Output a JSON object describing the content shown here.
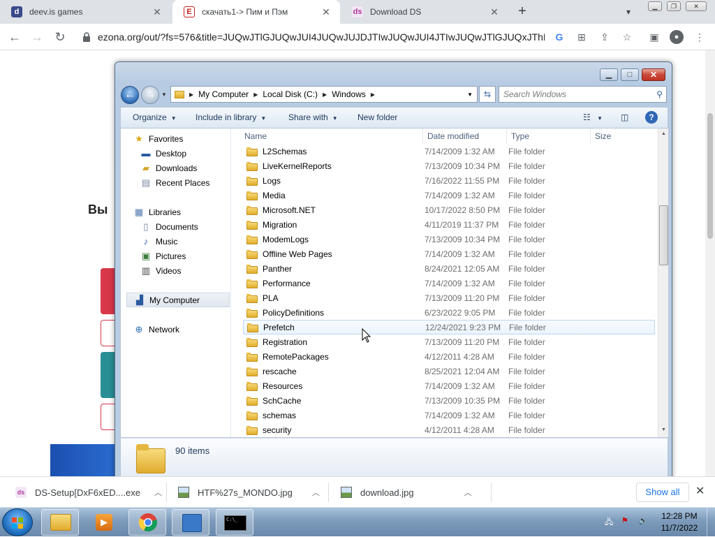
{
  "browser": {
    "tabs": [
      {
        "title": "deev.is games",
        "icon": "d-icon",
        "active": false
      },
      {
        "title": "скачать1-> Пим и Пэм",
        "icon": "e-icon",
        "active": true
      },
      {
        "title": "Download DS",
        "icon": "ds-icon",
        "active": false
      }
    ],
    "url": "ezona.org/out/?fs=576&title=JUQwJTlGJUQwJUI4JUQwJUJDJTIwJUQwJUI4JTIwJUQwJTlGJUQxJThEJU..."
  },
  "page": {
    "heading_fragment": "Вы",
    "colors": {
      "red": "#d8384a",
      "teal": "#2a8e96",
      "blue": "#1a56b0"
    }
  },
  "explorer": {
    "breadcrumb": [
      "My Computer",
      "Local Disk (C:)",
      "Windows"
    ],
    "search_placeholder": "Search Windows",
    "commands": {
      "organize": "Organize",
      "include": "Include in library",
      "share": "Share with",
      "newfolder": "New folder"
    },
    "nav": {
      "favorites": "Favorites",
      "desktop": "Desktop",
      "downloads": "Downloads",
      "recent": "Recent Places",
      "libraries": "Libraries",
      "documents": "Documents",
      "music": "Music",
      "pictures": "Pictures",
      "videos": "Videos",
      "computer": "My Computer",
      "network": "Network"
    },
    "columns": {
      "name": "Name",
      "date": "Date modified",
      "type": "Type",
      "size": "Size"
    },
    "files": [
      {
        "name": "L2Schemas",
        "date": "7/14/2009 1:32 AM",
        "type": "File folder"
      },
      {
        "name": "LiveKernelReports",
        "date": "7/13/2009 10:34 PM",
        "type": "File folder"
      },
      {
        "name": "Logs",
        "date": "7/16/2022 11:55 PM",
        "type": "File folder"
      },
      {
        "name": "Media",
        "date": "7/14/2009 1:32 AM",
        "type": "File folder"
      },
      {
        "name": "Microsoft.NET",
        "date": "10/17/2022 8:50 PM",
        "type": "File folder"
      },
      {
        "name": "Migration",
        "date": "4/11/2019 11:37 PM",
        "type": "File folder"
      },
      {
        "name": "ModemLogs",
        "date": "7/13/2009 10:34 PM",
        "type": "File folder"
      },
      {
        "name": "Offline Web Pages",
        "date": "7/14/2009 1:32 AM",
        "type": "File folder"
      },
      {
        "name": "Panther",
        "date": "8/24/2021 12:05 AM",
        "type": "File folder"
      },
      {
        "name": "Performance",
        "date": "7/14/2009 1:32 AM",
        "type": "File folder"
      },
      {
        "name": "PLA",
        "date": "7/13/2009 11:20 PM",
        "type": "File folder"
      },
      {
        "name": "PolicyDefinitions",
        "date": "6/23/2022 9:05 PM",
        "type": "File folder"
      },
      {
        "name": "Prefetch",
        "date": "12/24/2021 9:23 PM",
        "type": "File folder"
      },
      {
        "name": "Registration",
        "date": "7/13/2009 11:20 PM",
        "type": "File folder"
      },
      {
        "name": "RemotePackages",
        "date": "4/12/2011 4:28 AM",
        "type": "File folder"
      },
      {
        "name": "rescache",
        "date": "8/25/2021 12:04 AM",
        "type": "File folder"
      },
      {
        "name": "Resources",
        "date": "7/14/2009 1:32 AM",
        "type": "File folder"
      },
      {
        "name": "SchCache",
        "date": "7/13/2009 10:35 PM",
        "type": "File folder"
      },
      {
        "name": "schemas",
        "date": "7/14/2009 1:32 AM",
        "type": "File folder"
      },
      {
        "name": "security",
        "date": "4/12/2011 4:28 AM",
        "type": "File folder"
      }
    ],
    "hovered_file": "Prefetch",
    "item_count": "90 items"
  },
  "downloads": {
    "items": [
      {
        "name": "DS-Setup[DxF6xED....exe",
        "icon": "ds-setup-icon"
      },
      {
        "name": "HTF%27s_MONDO.jpg",
        "icon": "image-file-icon"
      },
      {
        "name": "download.jpg",
        "icon": "image-file-icon"
      }
    ],
    "show_all": "Show all"
  },
  "taskbar": {
    "time": "12:28 PM",
    "date": "11/7/2022"
  }
}
